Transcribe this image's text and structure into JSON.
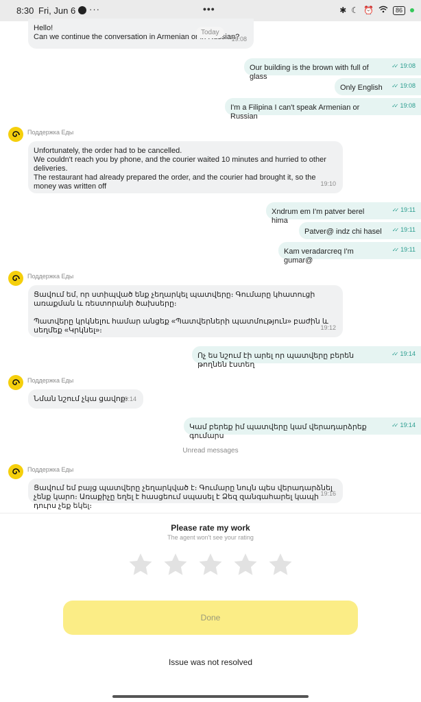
{
  "status_bar": {
    "time": "8:30",
    "date": "Fri, Jun 6",
    "more": "···",
    "center_dots": "•••",
    "battery": "86"
  },
  "chat": {
    "today_label": "Today",
    "agent_name": "Поддержка Еды",
    "unread_label": "Unread messages",
    "messages": [
      {
        "dir": "in",
        "text": "Hello!\nCan we continue the conversation in Armenian or in Russian?",
        "time": "19:08"
      },
      {
        "dir": "out",
        "text": "Our building is the brown with full of glass",
        "time": "19:08"
      },
      {
        "dir": "out",
        "text": "Only English",
        "time": "19:08"
      },
      {
        "dir": "out",
        "text": "I'm a Filipina I can't speak Armenian or Russian",
        "time": "19:08"
      },
      {
        "dir": "in",
        "text": "Unfortunately, the order had to be cancelled.\nWe couldn't reach you by phone, and the courier waited 10 minutes and hurried to other deliveries.\nThe restaurant had already prepared the order, and the courier had brought it, so the money was written off",
        "time": "19:10"
      },
      {
        "dir": "out",
        "text": "Xndrum em I'm patver berel hima",
        "time": "19:11"
      },
      {
        "dir": "out",
        "text": "Patver@ indz chi hasel",
        "time": "19:11"
      },
      {
        "dir": "out",
        "text": "Kam veradarcreq I'm gumar@",
        "time": "19:11"
      },
      {
        "dir": "in",
        "text": "Ցավում եմ, որ ստիպված ենք չեղարկել պատվերը։ Գումարը կհատուցի առաքման և ռեստորանի ծախսերը։\n\nՊատվերը կրկնելու համար անցեք «Պատվերների պատմություն» բաժին և սեղմեք «Կրկնել»։",
        "time": "19:12"
      },
      {
        "dir": "out",
        "text": "Ոչ ես նշում էի արել որ պատվերը բերեն թողնեն էստեղ",
        "time": "19:14"
      },
      {
        "dir": "in",
        "text": "Նման նշում չկա ցավոք։",
        "time": "19:14"
      },
      {
        "dir": "out",
        "text": "Կամ բերեք իմ պատվերը կամ վերադարձրեք գումարս",
        "time": "19:14"
      },
      {
        "dir": "in",
        "text": "Ցավում եմ բայց պատվերը չեղարկված է։ Գումարը նույն պես վերադարձնել չենք կարո։ Առաքիչը եղել է հասցեում սպասել է Ձեզ զանգահարել կապի դուրս չեք եկել։",
        "time": "19:16"
      }
    ]
  },
  "rating": {
    "title": "Please rate my work",
    "subtitle": "The agent won't see your rating",
    "stars": 5,
    "done_label": "Done",
    "unresolved_label": "Issue was not resolved"
  },
  "colors": {
    "accent_yellow": "#fbed86",
    "avatar_yellow": "#f5cf0c",
    "outgoing_bubble": "#e6f4f2",
    "incoming_bubble": "#f0f1f2",
    "check_teal": "#2a9d8f"
  }
}
